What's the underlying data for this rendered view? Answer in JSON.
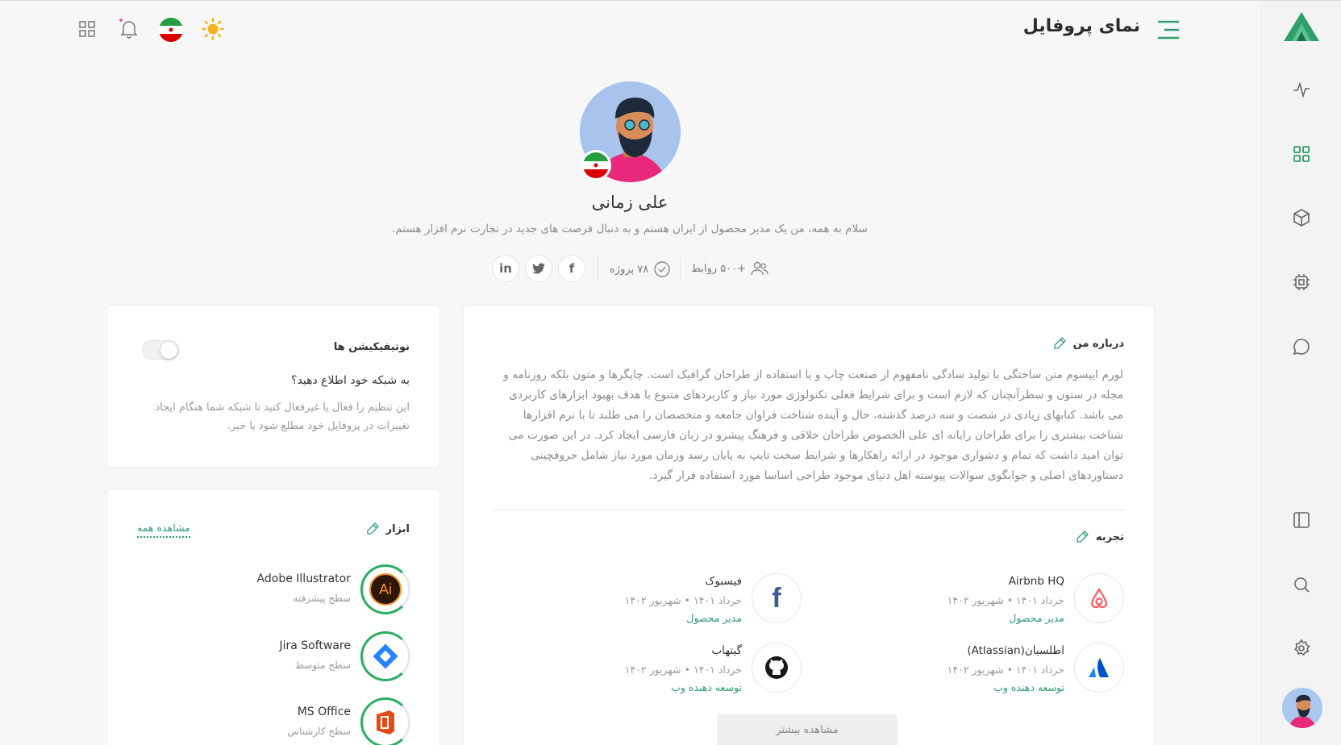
{
  "header": {
    "title": "نمای پروفایل",
    "flag": "Iran flag",
    "icons": [
      "apps-grid-icon",
      "bell-icon",
      "flag-icon",
      "sun-icon",
      "menu-icon"
    ]
  },
  "sidebar": {
    "items": [
      "logo",
      "activity-icon",
      "dashboard-icon",
      "cube-icon",
      "chip-icon",
      "chat-icon",
      "sidebar-layout-icon",
      "search-icon",
      "settings-icon",
      "avatar"
    ]
  },
  "profile": {
    "name": "علی زمانی",
    "bio": "سلام به همه، من یک مدیر محصول از ایران هستم و به دنبال فرصت های جدید در تجارت نرم افزار هستم.",
    "connections": "+۵۰۰ روابط",
    "projects": "۷۸ پروژه",
    "social": [
      "in",
      "twitter",
      "f"
    ]
  },
  "notifications": {
    "title": "نوتیفیکیشن ها",
    "question": "به شبکه خود اطلاع دهید؟",
    "desc": "این تنظیم را فعال یا غیرفعال کنید تا شبکه شما هنگام ایجاد تغییرات در پروفایل خود مطلع شود یا خیر.",
    "enabled": false
  },
  "tools": {
    "title": "ابزار",
    "view_all": "مشاهده همه",
    "items": [
      {
        "name": "Adobe Illustrator",
        "level": "سطح پیشرفته",
        "logo": "Ai"
      },
      {
        "name": "Jira Software",
        "level": "سطح متوسط",
        "logo": "jira-icon"
      },
      {
        "name": "MS Office",
        "level": "سطح کارشناس",
        "logo": "office-icon"
      }
    ]
  },
  "about": {
    "title": "درباره من",
    "body": "لورم ایپسوم متن ساختگی با تولید سادگی نامفهوم از صنعت چاپ و با استفاده از طراحان گرافیک است. چاپگرها و متون بلکه روزنامه و مجله در ستون و سطرآنچنان که لازم است و برای شرایط فعلی تکنولوژی مورد نیاز و کاربردهای متنوع با هدف بهبود ابزارهای کاربردی می باشد. کتابهای زیادی در شصت و سه درصد گذشته، حال و آینده شناخت فراوان جامعه و متخصصان را می طلبد تا با نرم افزارها شناخت بیشتری را برای طراحان رایانه ای علی الخصوص طراحان خلاقی و فرهنگ پیشرو در زبان فارسی ایجاد کرد. در این صورت می توان امید داشت که تمام و دشواری موجود در ارائه راهکارها و شرایط سخت تایپ به پایان رسد وزمان مورد نیاز شامل حروفچینی دستاوردهای اصلی و جوابگوی سوالات پیوسته اهل دنیای موجود طراحی اساسا مورد استفاده قرار گیرد."
  },
  "experience": {
    "title": "تجربه",
    "items": [
      {
        "company": "Airbnb HQ",
        "date": "خرداد ۱۴۰۱ • شهریور ۱۴۰۲",
        "role": "مدیر محصول",
        "logo": "airbnb-icon"
      },
      {
        "company": "فیسبوک",
        "date": "خرداد ۱۴۰۱ • شهریور ۱۴۰۲",
        "role": "مدیر محصول",
        "logo": "facebook-icon"
      },
      {
        "company": "اطلسیان(Atlassian)",
        "date": "خرداد ۱۴۰۱ • شهریور ۱۴۰۲",
        "role": "توسعه دهنده وب",
        "logo": "atlassian-icon"
      },
      {
        "company": "گیتهاب",
        "date": "خرداد ۱۴۰۱ • شهریور ۱۴۰۲",
        "role": "توسعه دهنده وب",
        "logo": "github-icon"
      }
    ],
    "more": "مشاهده بیشتر"
  },
  "colors": {
    "accent": "#2e9e6b",
    "background": "#f7f7f7"
  }
}
